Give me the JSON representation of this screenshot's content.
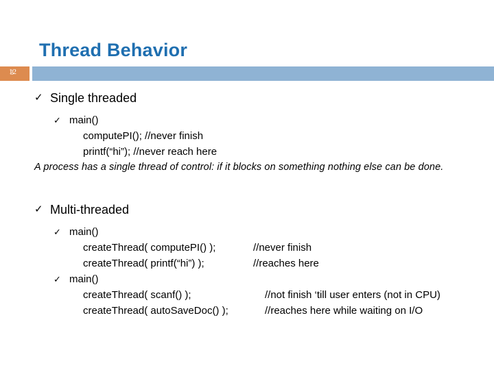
{
  "slide": {
    "title": "Thread Behavior",
    "number": "12",
    "number_overlay": "3",
    "accent_title_color": "#1F6FB0",
    "band_color": "#8FB3D4",
    "badge_color": "#DD8B4F",
    "bullet_glyph": "✓"
  },
  "sections": [
    {
      "heading": "Single threaded",
      "sub_heading": "main()",
      "code_lines": [
        {
          "code": "computePI(); //never finish",
          "comment": ""
        },
        {
          "code": "printf(“hi”); //never reach here",
          "comment": ""
        }
      ],
      "note": "A process has a single thread of control: if it blocks on something nothing else can be done."
    },
    {
      "heading": "Multi-threaded",
      "sub_heading_1": "main()",
      "sub_heading_2": "main()",
      "code_lines_1": [
        {
          "code": "createThread( computePI() );",
          "comment": "//never finish"
        },
        {
          "code": "createThread( printf(“hi”) );",
          "comment": "//reaches here"
        }
      ],
      "code_lines_2": [
        {
          "code": "createThread( scanf() );",
          "comment": "//not finish ‘till user enters (not in CPU)"
        },
        {
          "code": "createThread( autoSaveDoc() );",
          "comment": "//reaches here while waiting on I/O"
        }
      ]
    }
  ]
}
